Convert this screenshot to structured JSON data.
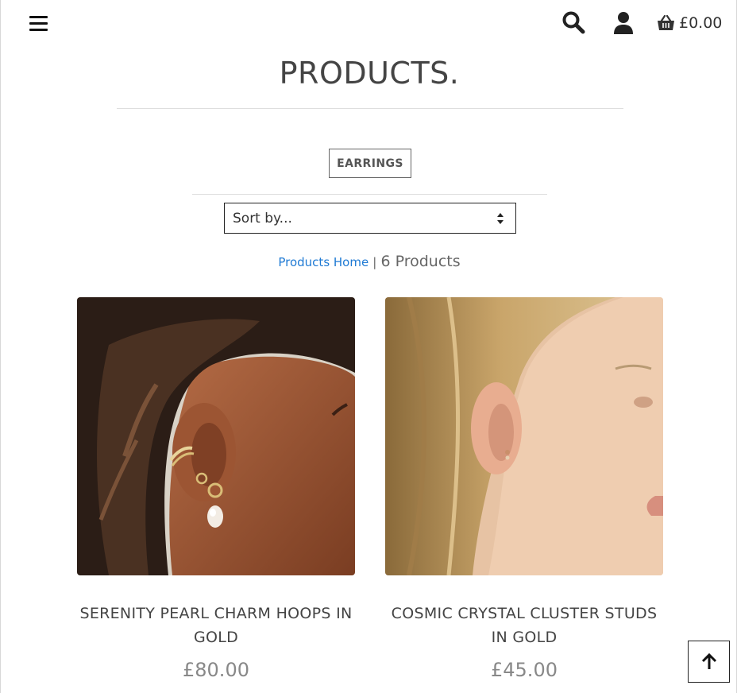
{
  "header": {
    "menu_icon": "hamburger-icon",
    "search_icon": "search-icon",
    "account_icon": "user-icon",
    "basket_icon": "shopping-basket-icon",
    "basket_total": "£0.00"
  },
  "page": {
    "title": "PRODUCTS.",
    "category_tag": "EARRINGS",
    "sort": {
      "selected": "Sort by..."
    },
    "breadcrumb": {
      "home_link": "Products Home",
      "separator": "|",
      "count": "6 Products"
    }
  },
  "products": [
    {
      "name": "SERENITY PEARL CHARM HOOPS IN GOLD",
      "price": "£80.00"
    },
    {
      "name": "COSMIC CRYSTAL CLUSTER STUDS IN GOLD",
      "price": "£45.00"
    }
  ],
  "back_to_top_icon": "arrow-up-icon",
  "colors": {
    "link": "#1f7ad4",
    "text": "#444444",
    "price": "#888888"
  }
}
